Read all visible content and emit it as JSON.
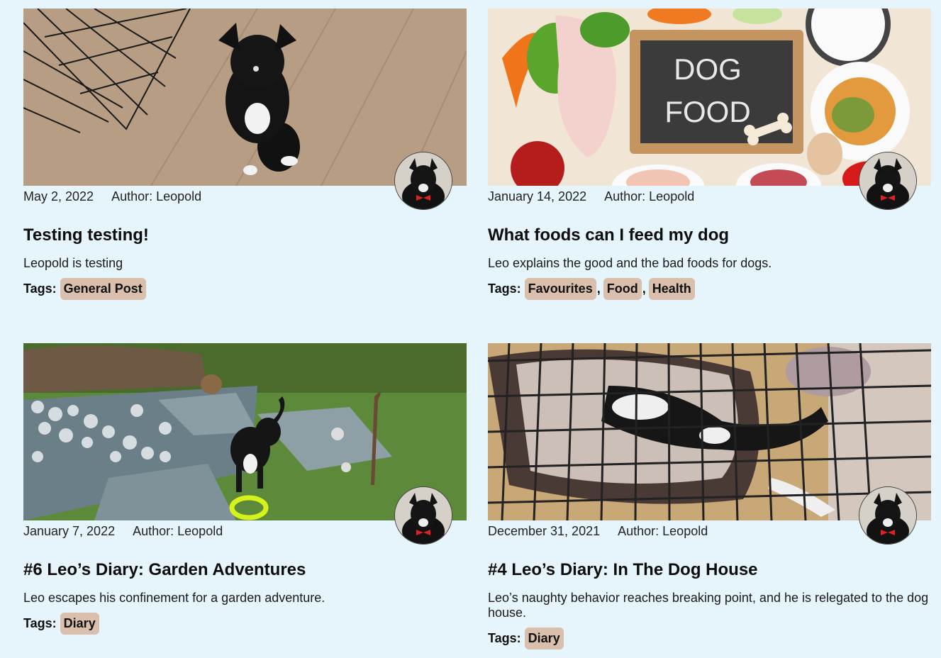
{
  "posts": [
    {
      "date": "May 2, 2022",
      "author": "Author: Leopold",
      "title": "Testing testing!",
      "excerpt": "Leopold is testing",
      "tags_label": "Tags:",
      "tags": [
        "General Post"
      ]
    },
    {
      "date": "January 14, 2022",
      "author": "Author: Leopold",
      "title": "What foods can I feed my dog",
      "excerpt": "Leo explains the good and the bad foods for dogs.",
      "tags_label": "Tags:",
      "tags": [
        "Favourites",
        "Food",
        "Health"
      ],
      "image_text": [
        "DOG",
        "FOOD"
      ]
    },
    {
      "date": "January 7, 2022",
      "author": "Author: Leopold",
      "title": "#6 Leo’s Diary: Garden Adventures",
      "excerpt": "Leo escapes his confinement for a garden adventure.",
      "tags_label": "Tags:",
      "tags": [
        "Diary"
      ]
    },
    {
      "date": "December 31, 2021",
      "author": "Author: Leopold",
      "title": "#4 Leo’s Diary: In The Dog House",
      "excerpt": "Leo’s naughty behavior reaches breaking point, and he is relegated to the dog house.",
      "tags_label": "Tags:",
      "tags": [
        "Diary"
      ]
    }
  ],
  "colors": {
    "background": "#e6f4fc",
    "tag_bg": "#d9bfac"
  }
}
